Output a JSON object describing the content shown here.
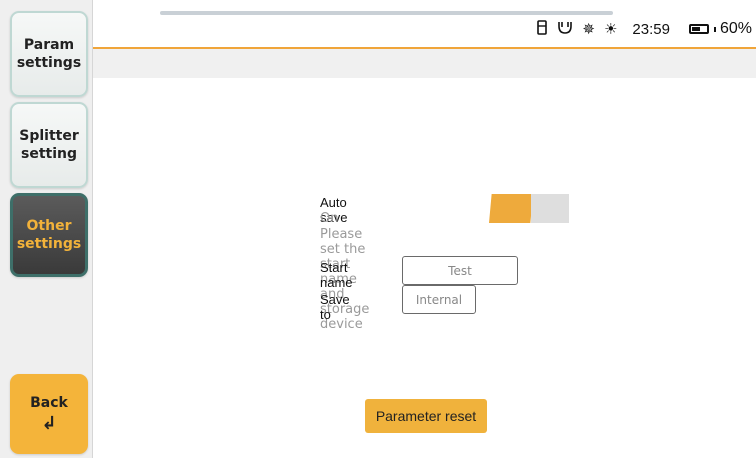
{
  "sidebar": {
    "items": [
      {
        "label": "Param settings"
      },
      {
        "label": "Splitter setting"
      },
      {
        "label": "Other settings"
      }
    ],
    "back": {
      "label": "Back",
      "arrow": "↲"
    }
  },
  "status": {
    "time": "23:59",
    "battery": "60%",
    "battery_level": 0.6,
    "icons": [
      "usb-icon",
      "plug-icon",
      "brightness-icon",
      "sun-icon"
    ]
  },
  "settings": {
    "auto_save_label": "Auto save",
    "auto_save_state": "On",
    "hint": "Please set the start name and storage device",
    "start_name_label": "Start name",
    "start_name_value": "Test",
    "save_to_label": "Save to",
    "save_to_value": "Internal",
    "reset_label": "Parameter reset"
  },
  "colors": {
    "accent": "#f0b23c",
    "toggle_on": "#eeaa3c",
    "active_text": "#f2b23a",
    "divider": "#f0a53a"
  }
}
